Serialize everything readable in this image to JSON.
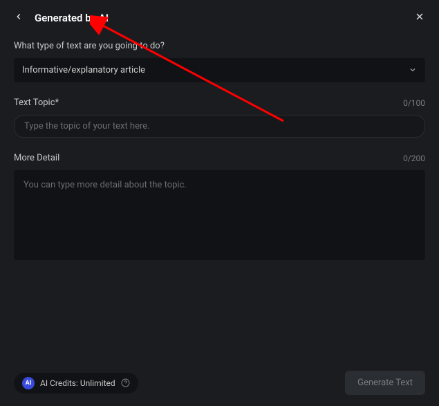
{
  "header": {
    "title": "Generated by AI"
  },
  "fields": {
    "type": {
      "label": "What type of text are you going to do?",
      "selected": "Informative/explanatory article"
    },
    "topic": {
      "label": "Text Topic*",
      "placeholder": "Type the topic of your text here.",
      "value": "",
      "count": "0/100"
    },
    "detail": {
      "label": "More Detail",
      "placeholder": "You can type more detail about the topic.",
      "value": "",
      "count": "0/200"
    }
  },
  "footer": {
    "ai_badge": "AI",
    "credits_text": "AI Credits: Unlimited",
    "generate_label": "Generate Text"
  },
  "colors": {
    "accent": "#3a4bdb",
    "arrow": "#ff0000"
  }
}
